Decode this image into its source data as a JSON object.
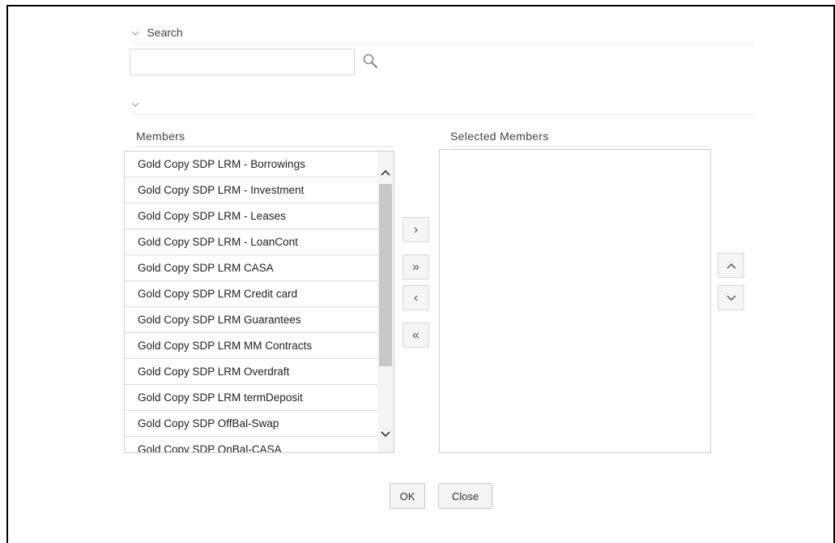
{
  "search": {
    "header_label": "Search",
    "input_value": "",
    "input_placeholder": ""
  },
  "members": {
    "title": "Members",
    "items": [
      "Gold Copy SDP LRM - Borrowings",
      "Gold Copy SDP LRM - Investment",
      "Gold Copy SDP LRM - Leases",
      "Gold Copy SDP LRM - LoanCont",
      "Gold Copy SDP LRM CASA",
      "Gold Copy SDP LRM Credit card",
      "Gold Copy SDP LRM Guarantees",
      "Gold Copy SDP LRM MM Contracts",
      "Gold Copy SDP LRM Overdraft",
      "Gold Copy SDP LRM termDeposit",
      "Gold Copy SDP OffBal-Swap",
      "Gold Copy SDP OnBal-CASA"
    ]
  },
  "selected_members": {
    "title": "Selected Members",
    "items": []
  },
  "shuttle": {
    "move_one": "›",
    "move_all": "»",
    "remove_one": "‹",
    "remove_all": "«"
  },
  "footer": {
    "ok_label": "OK",
    "close_label": "Close"
  },
  "icons": {
    "search": "magnifier-icon",
    "collapse": "chevron-down-icon"
  },
  "colors": {
    "border": "#cfcfcf",
    "button_bg": "#f5f5f5",
    "text": "#333333"
  }
}
